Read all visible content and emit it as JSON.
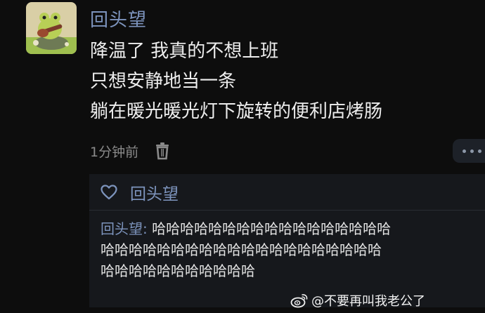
{
  "post": {
    "author": "回头望",
    "lines": [
      "降温了 我真的不想上班",
      "只想安静地当一条",
      "躺在暖光暖光灯下旋转的便利店烤肠"
    ],
    "time": "1分钟前"
  },
  "likes": {
    "user": "回头望"
  },
  "reply": {
    "author": "回头望:",
    "lines": [
      " 哈哈哈哈哈哈哈哈哈哈哈哈哈哈哈哈哈",
      "哈哈哈哈哈哈哈哈哈哈哈哈哈哈哈哈哈哈哈哈",
      "哈哈哈哈哈哈哈哈哈哈哈"
    ]
  },
  "watermark": {
    "text": "@不要再叫我老公了"
  },
  "icons": {
    "avatar": "frog-with-guitar-avatar",
    "delete": "trash-icon",
    "more": "more-dots-icon",
    "like": "heart-outline-icon",
    "brand": "weibo-logo-icon"
  },
  "colors": {
    "background": "#0d0d0d",
    "username": "#7d94bd",
    "panel": "#16181c"
  }
}
